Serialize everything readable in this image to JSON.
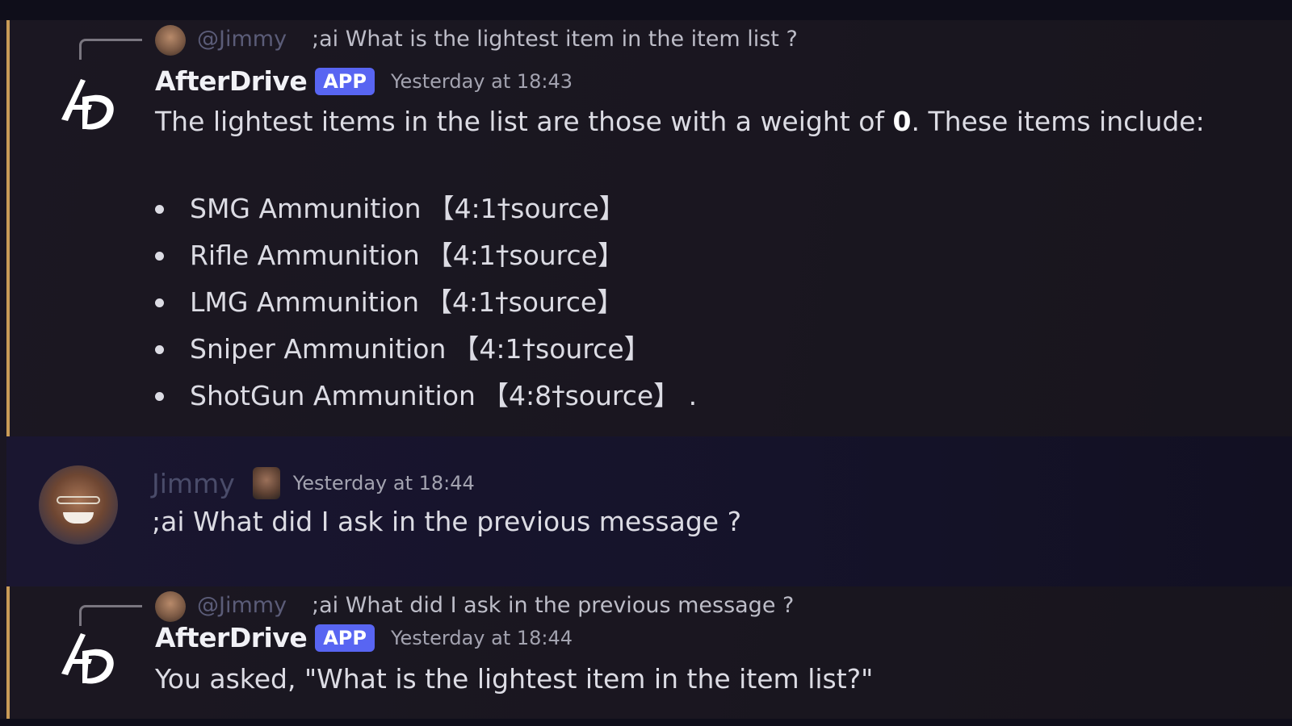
{
  "messages": [
    {
      "reply": {
        "mention": "@Jimmy",
        "text": ";ai What is the lightest item in the item list ?"
      },
      "author": "AfterDrive",
      "badge": "APP",
      "timestamp": "Yesterday at 18:43",
      "text_before": "The lightest items in the list are those with a weight of ",
      "text_bold": "0",
      "text_after": ". These items include:",
      "items": [
        {
          "name": "SMG Ammunition",
          "source": "【4:1†source】",
          "suffix": ""
        },
        {
          "name": "Rifle Ammunition",
          "source": "【4:1†source】",
          "suffix": ""
        },
        {
          "name": "LMG Ammunition",
          "source": "【4:1†source】",
          "suffix": ""
        },
        {
          "name": "Sniper Ammunition",
          "source": "【4:1†source】",
          "suffix": ""
        },
        {
          "name": "ShotGun Ammunition",
          "source": "【4:8†source】",
          "suffix": " ."
        }
      ]
    },
    {
      "author": "Jimmy",
      "timestamp": "Yesterday at 18:44",
      "text": ";ai What did I ask in the previous message ?"
    },
    {
      "reply": {
        "mention": "@Jimmy",
        "text": ";ai What did I ask in the previous message ?"
      },
      "author": "AfterDrive",
      "badge": "APP",
      "timestamp": "Yesterday at 18:44",
      "text": "You asked, \"What is the lightest item in the item list?\""
    }
  ],
  "colors": {
    "accent_bar": "#c99b57",
    "app_badge": "#5865f2",
    "mention": "#5b5c78"
  }
}
